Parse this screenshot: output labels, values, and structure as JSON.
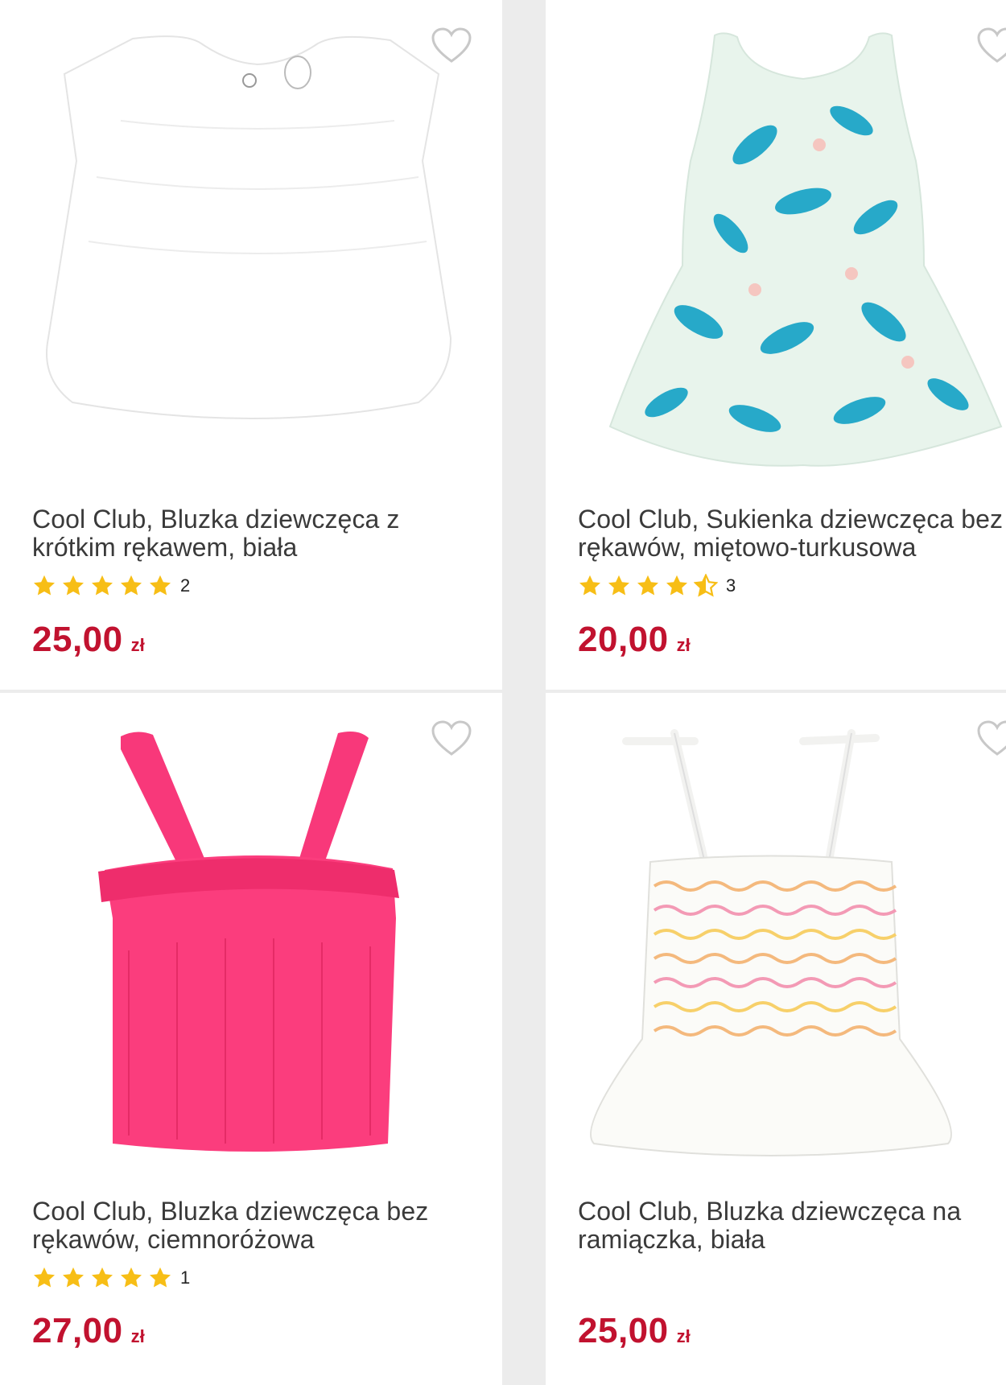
{
  "products": [
    {
      "title": "Cool Club, Bluzka dziewczęca z krótkim rękawem, biała",
      "rating_count": "2",
      "rating_stars": 5,
      "price": "25,00",
      "currency": "zł",
      "image_icon": "white-ruffle-blouse"
    },
    {
      "title": "Cool Club, Sukienka dziewczęca bez rękawów, miętowo-turkusowa",
      "rating_count": "3",
      "rating_stars": 4.5,
      "price": "20,00",
      "currency": "zł",
      "image_icon": "mint-turquoise-leaf-dress"
    },
    {
      "title": "Cool Club, Bluzka dziewczęca bez rękawów, ciemnoróżowa",
      "rating_count": "1",
      "rating_stars": 5,
      "price": "27,00",
      "currency": "zł",
      "image_icon": "pink-strap-top"
    },
    {
      "title": "Cool Club, Bluzka dziewczęca na ramiączka, biała",
      "rating_count": "",
      "rating_stars": 0,
      "price": "25,00",
      "currency": "zł",
      "image_icon": "white-smocked-strap-top"
    }
  ],
  "colors": {
    "price": "#c1122f",
    "star": "#f7be16",
    "heart": "#c8c8c8",
    "background": "#ececec"
  }
}
